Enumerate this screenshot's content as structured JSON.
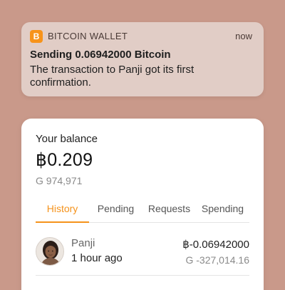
{
  "notification": {
    "app_icon_glyph": "B",
    "app_name": "BITCOIN WALLET",
    "time": "now",
    "title": "Sending 0.06942000 Bitcoin",
    "body": "The transaction to Panji got its first confirmation.",
    "icon_color": "#f7931a"
  },
  "wallet": {
    "balance_label": "Your balance",
    "balance_amount": "฿0.209",
    "balance_fiat": "G 974,971",
    "tabs": [
      {
        "label": "History",
        "active": true
      },
      {
        "label": "Pending",
        "active": false
      },
      {
        "label": "Requests",
        "active": false
      },
      {
        "label": "Spending",
        "active": false
      }
    ],
    "accent_color": "#f5931c",
    "transactions": [
      {
        "name": "Panji",
        "time": "1 hour ago",
        "amount": "฿-0.06942000",
        "fiat": "G -327,014.16",
        "avatar": "person-avatar"
      }
    ]
  }
}
